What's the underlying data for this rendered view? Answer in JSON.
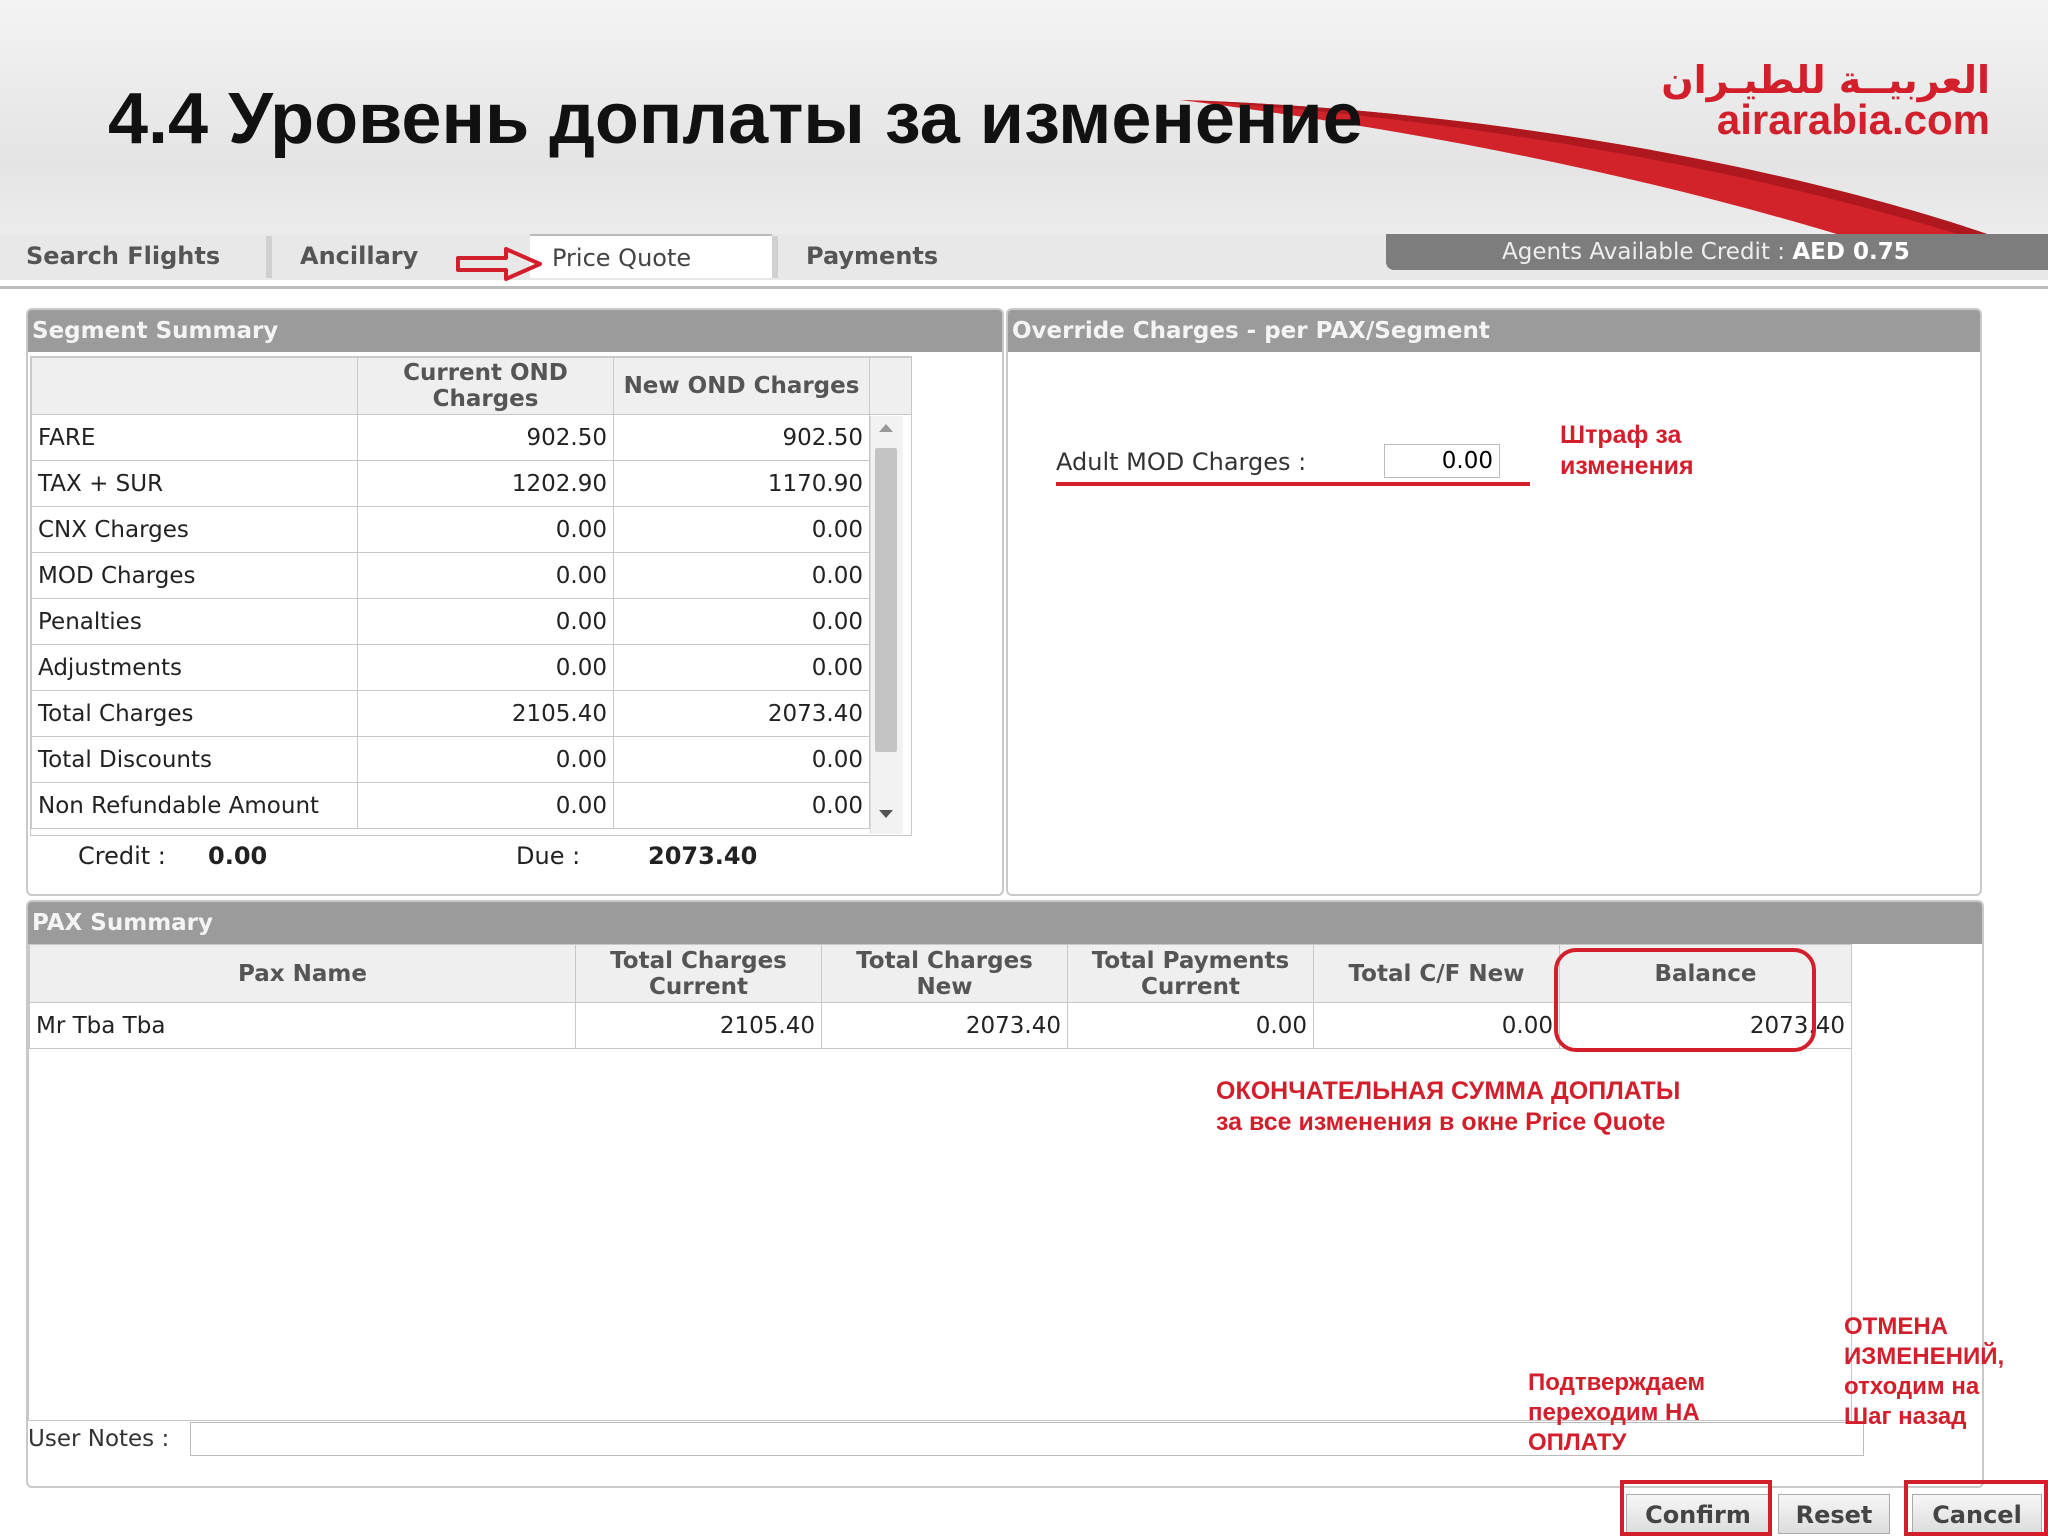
{
  "slide": {
    "title": "4.4 Уровень доплаты за изменение",
    "logo_arabic": "العربيــة للطيـران",
    "logo_text": "airarabia.com"
  },
  "tabs": [
    {
      "label": "Search Flights"
    },
    {
      "label": "Ancillary"
    },
    {
      "label": "Price Quote"
    },
    {
      "label": "Payments"
    }
  ],
  "agent_credit": {
    "label": "Agents Available Credit :",
    "value": "AED 0.75"
  },
  "segment_summary": {
    "title": "Segment Summary",
    "headers": [
      "",
      "Current OND Charges",
      "New OND Charges"
    ],
    "rows": [
      {
        "label": "FARE",
        "current": "902.50",
        "new": "902.50"
      },
      {
        "label": "TAX + SUR",
        "current": "1202.90",
        "new": "1170.90"
      },
      {
        "label": "CNX Charges",
        "current": "0.00",
        "new": "0.00"
      },
      {
        "label": "MOD Charges",
        "current": "0.00",
        "new": "0.00"
      },
      {
        "label": "Penalties",
        "current": "0.00",
        "new": "0.00"
      },
      {
        "label": "Adjustments",
        "current": "0.00",
        "new": "0.00"
      },
      {
        "label": "Total Charges",
        "current": "2105.40",
        "new": "2073.40"
      },
      {
        "label": "Total Discounts",
        "current": "0.00",
        "new": "0.00"
      },
      {
        "label": "Non Refundable Amount",
        "current": "0.00",
        "new": "0.00"
      }
    ],
    "credit_label": "Credit :",
    "credit_value": "0.00",
    "due_label": "Due :",
    "due_value": "2073.40"
  },
  "override": {
    "title": "Override Charges - per PAX/Segment",
    "adult_mod_label": "Adult MOD Charges :",
    "adult_mod_value": "0.00"
  },
  "pax_summary": {
    "title": "PAX Summary",
    "headers": [
      "Pax Name",
      "Total Charges Current",
      "Total Charges New",
      "Total Payments Current",
      "Total C/F New",
      "Balance"
    ],
    "rows": [
      {
        "name": "Mr Tba Tba",
        "charges_current": "2105.40",
        "charges_new": "2073.40",
        "payments_current": "0.00",
        "cf_new": "0.00",
        "balance": "2073.40"
      }
    ]
  },
  "user_notes": {
    "label": "User Notes :",
    "value": ""
  },
  "buttons": {
    "confirm": "Confirm",
    "reset": "Reset",
    "cancel": "Cancel"
  },
  "annotations": {
    "penalty_line1": "Штраф за",
    "penalty_line2": "изменения",
    "final_line1": "ОКОНЧАТЕЛЬНАЯ СУММА ДОПЛАТЫ",
    "final_line2": "за все изменения в окне Price Quote",
    "confirm_line1": "Подтверждаем",
    "confirm_line2": "переходим НА",
    "confirm_line3": "ОПЛАТУ",
    "cancel_line1": "ОТМЕНА",
    "cancel_line2": "ИЗМЕНЕНИЙ,",
    "cancel_line3": "отходим на",
    "cancel_line4": "Шаг назад"
  },
  "colors": {
    "accent_red": "#d21f2b",
    "panel_header": "#9b9b9b"
  }
}
